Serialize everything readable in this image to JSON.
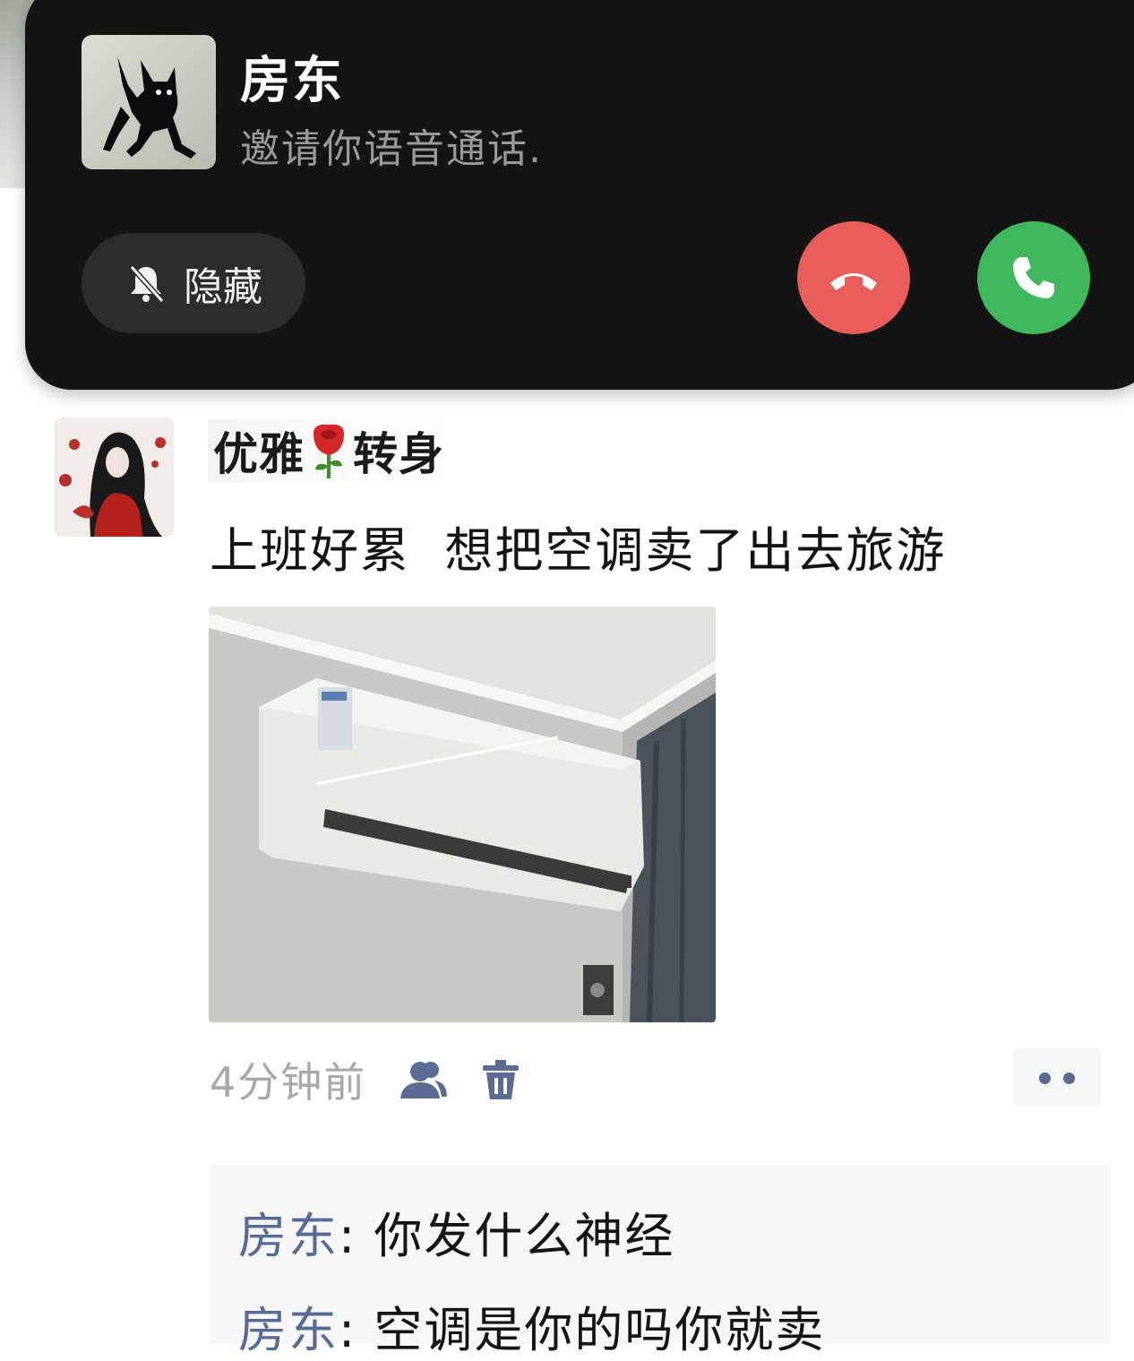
{
  "call": {
    "caller_name": "房东",
    "subtitle": "邀请你语音通话.",
    "hide_label": "隐藏",
    "icons": {
      "mute": "bell-off-icon",
      "decline": "phone-hangup-icon",
      "accept": "phone-icon"
    },
    "colors": {
      "banner": "#141414",
      "decline": "#e85d5c",
      "accept": "#3fb85d"
    }
  },
  "post": {
    "author_name_part1": "优雅",
    "author_name_part2": "转身",
    "text": "上班好累  想把空调卖了出去旅游",
    "time": "4分钟前",
    "icons": {
      "visibility": "people-icon",
      "delete": "trash-icon",
      "more": "more-dots-icon"
    }
  },
  "comments": [
    {
      "author": "房东",
      "separator": ": ",
      "text": "你发什么神经"
    },
    {
      "author": "房东",
      "separator": ": ",
      "text": "空调是你的吗你就卖"
    }
  ],
  "link_color": "#576b95"
}
